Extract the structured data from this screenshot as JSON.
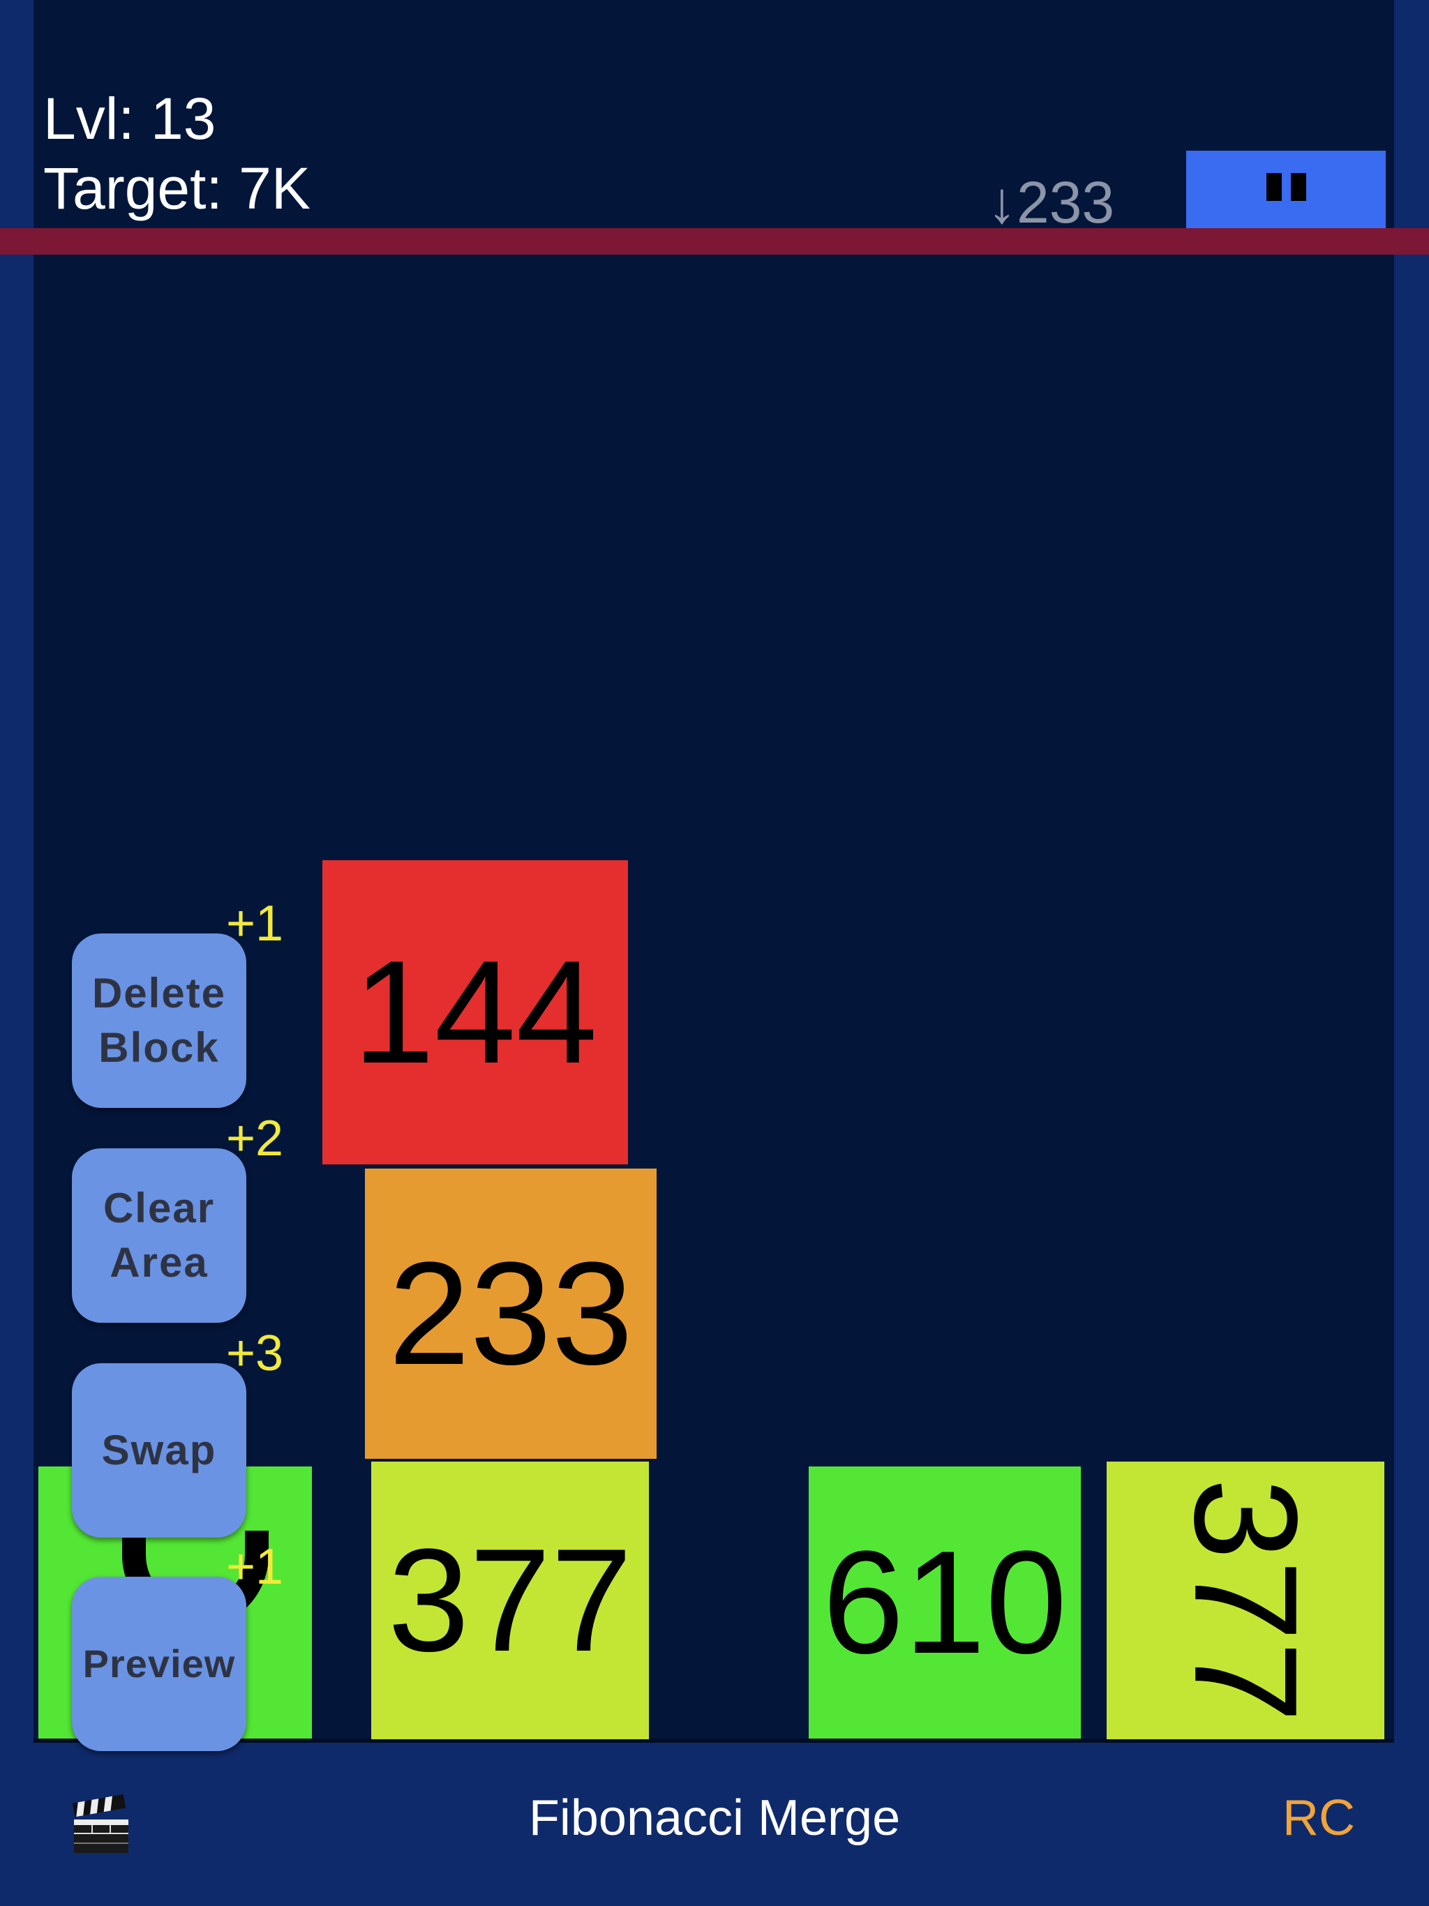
{
  "hud": {
    "level": "Lvl: 13",
    "target": "Target: 7K",
    "next_block": "↓233",
    "pause_icon": "pause-icon"
  },
  "board": {
    "tiles": [
      {
        "value": "144",
        "color": "#e52e2e"
      },
      {
        "value": "233",
        "color": "#e69b30"
      },
      {
        "value": "377",
        "color": "#c3e634"
      },
      {
        "value": "610",
        "color": "#54e634"
      },
      {
        "value": "377",
        "color": "#c3e634",
        "rotated": true
      },
      {
        "value": "",
        "color": "#54e634",
        "partially_hidden": true
      }
    ]
  },
  "powerups": [
    {
      "label_line1": "Delete",
      "label_line2": "Block",
      "count": "+1"
    },
    {
      "label_line1": "Clear",
      "label_line2": "Area",
      "count": "+2"
    },
    {
      "label_line1": "Swap",
      "label_line2": "",
      "count": "+3"
    },
    {
      "label_line1": "Preview",
      "label_line2": "",
      "count": "+1"
    }
  ],
  "footer": {
    "title": "Fibonacci Merge",
    "right_label": "RC",
    "left_icon": "clapperboard-icon"
  },
  "colors": {
    "background": "#0f2a6b",
    "board": "#03163a",
    "limit_line": "#7c1735",
    "pause_button": "#3a6cf2",
    "powerup_button": "#6a93e3",
    "badge_text": "#f2ea3a",
    "rc_text": "#f0a43a"
  }
}
